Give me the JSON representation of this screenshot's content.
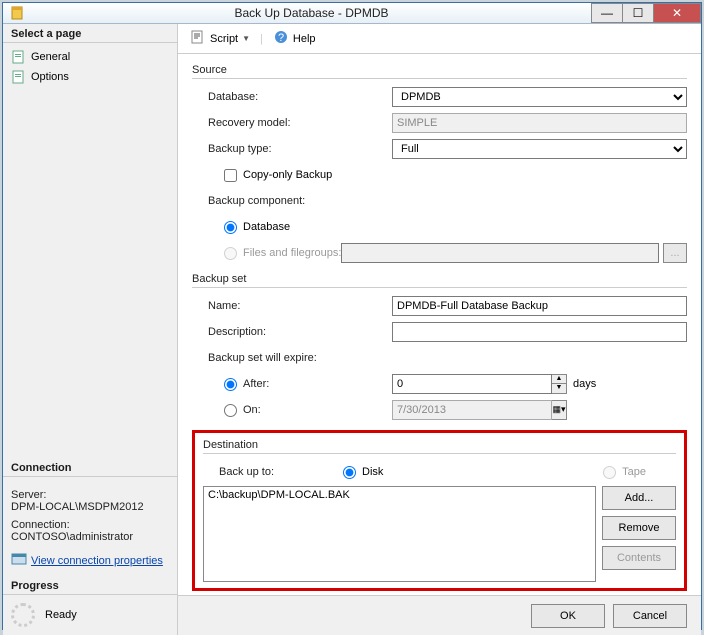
{
  "window": {
    "title": "Back Up Database - DPMDB"
  },
  "left": {
    "select_page": "Select a page",
    "nav": {
      "general": "General",
      "options": "Options"
    },
    "connection": {
      "header": "Connection",
      "server_label": "Server:",
      "server_value": "DPM-LOCAL\\MSDPM2012",
      "conn_label": "Connection:",
      "conn_value": "CONTOSO\\administrator",
      "view_props": "View connection properties"
    },
    "progress": {
      "header": "Progress",
      "status": "Ready"
    }
  },
  "toolbar": {
    "script": "Script",
    "help": "Help"
  },
  "source": {
    "title": "Source",
    "database_label": "Database:",
    "database_value": "DPMDB",
    "recovery_label": "Recovery model:",
    "recovery_value": "SIMPLE",
    "backup_type_label": "Backup type:",
    "backup_type_value": "Full",
    "copy_only": "Copy-only Backup",
    "component_label": "Backup component:",
    "component_db": "Database",
    "component_files": "Files and filegroups:"
  },
  "backup_set": {
    "title": "Backup set",
    "name_label": "Name:",
    "name_value": "DPMDB-Full Database Backup",
    "desc_label": "Description:",
    "desc_value": "",
    "expire_label": "Backup set will expire:",
    "after_label": "After:",
    "after_value": "0",
    "after_unit": "days",
    "on_label": "On:",
    "on_value": "7/30/2013"
  },
  "destination": {
    "title": "Destination",
    "backup_to": "Back up to:",
    "disk": "Disk",
    "tape": "Tape",
    "items": [
      "C:\\backup\\DPM-LOCAL.BAK"
    ],
    "add": "Add...",
    "remove": "Remove",
    "contents": "Contents"
  },
  "footer": {
    "ok": "OK",
    "cancel": "Cancel"
  }
}
